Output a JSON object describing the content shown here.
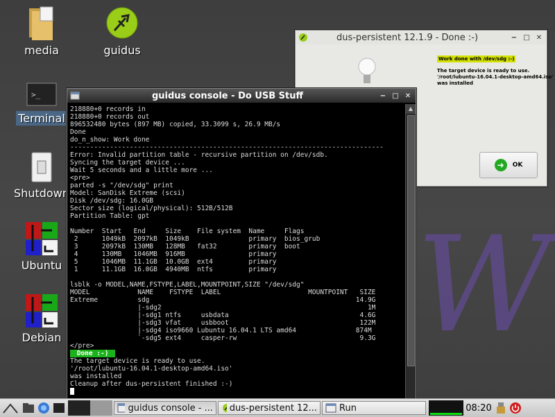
{
  "desktop": {
    "icons": [
      {
        "label": "media"
      },
      {
        "label": "guidus"
      },
      {
        "label": "Terminal"
      },
      {
        "label": "Shutdown"
      },
      {
        "label": "Ubuntu"
      },
      {
        "label": "Debian"
      }
    ]
  },
  "console": {
    "title": "guidus console - Do USB Stuff",
    "lines": [
      "218880+0 records in",
      "218880+0 records out",
      "896532480 bytes (897 MB) copied, 33.3099 s, 26.9 MB/s",
      "Done",
      "do_n_show: Work done",
      "-------------------------------------------------------------------------------",
      "Error: Invalid partition table - recursive partition on /dev/sdb.",
      "Syncing the target device ...",
      "Wait 5 seconds and a little more ...",
      "<pre>",
      "parted -s \"/dev/sdg\" print",
      "Model: SanDisk Extreme (scsi)",
      "Disk /dev/sdg: 16.0GB",
      "Sector size (logical/physical): 512B/512B",
      "Partition Table: gpt",
      "",
      "Number  Start   End     Size    File system  Name     Flags",
      " 2      1049kB  2097kB  1049kB               primary  bios_grub",
      " 3      2097kB  130MB   128MB   fat32        primary  boot",
      " 4      130MB   1046MB  916MB                primary",
      " 5      1046MB  11.1GB  10.0GB  ext4         primary",
      " 1      11.1GB  16.0GB  4940MB  ntfs         primary",
      "",
      "lsblk -o MODEL,NAME,FSTYPE,LABEL,MOUNTPOINT,SIZE \"/dev/sdg\"",
      "MODEL            NAME    FSTYPE  LABEL                      MOUNTPOINT   SIZE",
      "Extreme          sdg                                                    14.9G",
      "                 |-sdg2                                                    1M",
      "                 |-sdg1 ntfs     usbdata                                 4.6G",
      "                 |-sdg3 vfat     usbboot                                 122M",
      "                 |-sdg4 iso9660 Lubuntu 16.04.1 LTS amd64               874M",
      "                 `-sdg5 ext4     casper-rw                               9.3G",
      "</pre>"
    ],
    "done_badge": " Done :-) ",
    "after_lines": [
      "The target device is ready to use.",
      "'/root/lubuntu-16.04.1-desktop-amd64.iso'",
      "was installed",
      "Cleanup after dus-persistent finished :-)"
    ]
  },
  "dus_window": {
    "title": "dus-persistent 12.1.9 - Done :-)",
    "work_done": "Work done with /dev/sdg :-)",
    "message": "The target device is ready to use.\n'/root/lubuntu-16.04.1-desktop-amd64.iso'\nwas installed",
    "ok_label": "OK"
  },
  "taskbar": {
    "tasks": [
      {
        "label": "guidus console - ..."
      },
      {
        "label": "dus-persistent 12..."
      },
      {
        "label": "Run"
      }
    ],
    "clock": "08:20"
  }
}
